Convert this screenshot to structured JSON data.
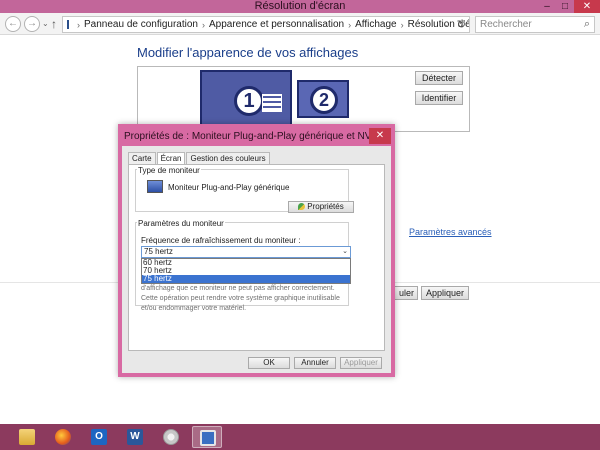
{
  "window": {
    "title": "Résolution d'écran",
    "min": "–",
    "max": "□",
    "close": "✕"
  },
  "nav": {
    "back": "←",
    "forward": "→",
    "recent": "⌄",
    "up": "↑",
    "breadcrumb": [
      "Panneau de configuration",
      "Apparence et personnalisation",
      "Affichage",
      "Résolution d'écran"
    ],
    "separator": "›",
    "dropdown": "⌄",
    "refresh": "↻",
    "search_placeholder": "Rechercher",
    "search_icon": "⌕"
  },
  "main": {
    "heading": "Modifier l'apparence de vos affichages",
    "monitors": [
      "1",
      "2"
    ],
    "detect_label": "Détecter",
    "identify_label": "Identifier",
    "advanced_link": "Paramètres avancés",
    "cancel_label": "uler",
    "apply_label": "Appliquer"
  },
  "dialog": {
    "title": "Propriétés de : Moniteur Plug-and-Play générique et NVIDIA Q...",
    "close": "✕",
    "tabs": [
      "Carte",
      "Écran",
      "Gestion des couleurs"
    ],
    "active_tab": "Écran",
    "monitor_type_group": "Type de moniteur",
    "monitor_type_value": "Moniteur Plug-and-Play générique",
    "properties_label": "Propriétés",
    "settings_group": "Paramètres du moniteur",
    "refresh_label": "Fréquence de rafraîchissement du moniteur :",
    "refresh_value": "75 hertz",
    "options": [
      "60 hertz",
      "70 hertz",
      "75 hertz"
    ],
    "selected_option": "75 hertz",
    "warning_text": "d'affichage que ce moniteur ne peut pas afficher correctement. Cette opération peut rendre votre système graphique inutilisable et/ou endommager votre matériel.",
    "ok_label": "OK",
    "cancel_label": "Annuler",
    "apply_label": "Appliquer"
  },
  "taskbar": {
    "items": [
      "file-explorer",
      "firefox",
      "outlook",
      "word",
      "paint",
      "display-settings"
    ],
    "outlook_glyph": "O",
    "word_glyph": "W"
  },
  "colors": {
    "accent": "#c2669a",
    "dialog_border": "#d86aa3",
    "taskbar": "#8c3a5e",
    "selection": "#3b73d0",
    "link": "#2a5fb8"
  }
}
